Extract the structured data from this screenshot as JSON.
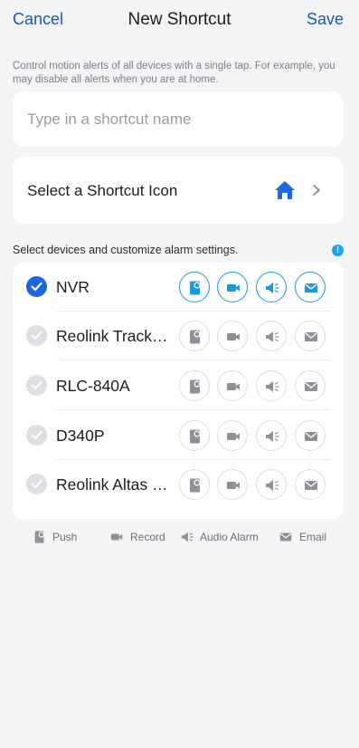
{
  "nav": {
    "cancel_label": "Cancel",
    "title": "New Shortcut",
    "save_label": "Save"
  },
  "hint": "Control motion alerts of all devices with a single tap. For example, you may disable all alerts when you are at home.",
  "name_field": {
    "value": "",
    "placeholder": "Type in a shortcut name"
  },
  "icon_select": {
    "label": "Select a Shortcut Icon",
    "icon": "home-icon"
  },
  "devices_section": {
    "label": "Select devices and customize alarm settings.",
    "info_icon": "info-icon"
  },
  "devices": [
    {
      "name": "NVR",
      "selected": true,
      "push": true,
      "record": true,
      "audio_alarm": true,
      "email": true
    },
    {
      "name": "Reolink TrackMix",
      "selected": false,
      "push": false,
      "record": false,
      "audio_alarm": false,
      "email": false
    },
    {
      "name": "RLC-840A",
      "selected": false,
      "push": false,
      "record": false,
      "audio_alarm": false,
      "email": false
    },
    {
      "name": "D340P",
      "selected": false,
      "push": false,
      "record": false,
      "audio_alarm": false,
      "email": false
    },
    {
      "name": "Reolink Altas PT Ultra",
      "selected": false,
      "push": false,
      "record": false,
      "audio_alarm": false,
      "email": false
    }
  ],
  "legend": {
    "push": "Push",
    "record": "Record",
    "audio_alarm": "Audio Alarm",
    "email": "Email"
  },
  "colors": {
    "accent": "#1a56b8",
    "checked": "#1a66e8",
    "active_icon": "#1a9ad8",
    "inactive_icon": "#8e9096",
    "info": "#1ea0e8"
  }
}
